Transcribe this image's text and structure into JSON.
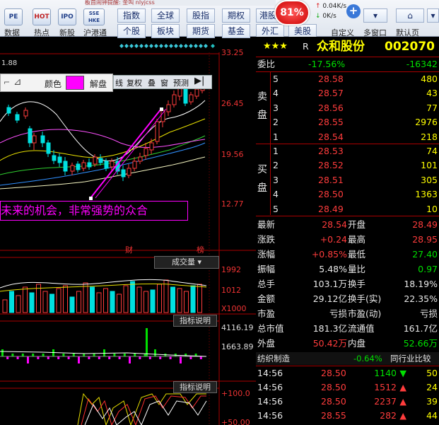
{
  "toolbar": {
    "title": "板首闹钟提醒: 金叫 nlyjcss",
    "icons": [
      {
        "name": "pe-icon",
        "text": "PE",
        "label": "数据"
      },
      {
        "name": "hot-icon",
        "text": "HOT",
        "label": "热点"
      },
      {
        "name": "new-icon",
        "text": "IPO",
        "label": "新股"
      },
      {
        "name": "ssehke-icon",
        "text": "SSE HKE",
        "label": "沪港通"
      }
    ],
    "nav_row1": [
      "指数",
      "全球",
      "股指",
      "期权",
      "港股"
    ],
    "nav_row2": [
      "个股",
      "板块",
      "期货",
      "基金",
      "外汇",
      "美股"
    ],
    "speed_percent": "81%",
    "net_up": "0.04K/s",
    "net_down": "0K/s",
    "right_labels": [
      "自定义",
      "多窗口",
      "默认页"
    ]
  },
  "chart_toolbar": {
    "color_label": "颜色",
    "unlock_label": "解盘",
    "buttons": [
      "线",
      "复权",
      "叠",
      "窗",
      "预测"
    ]
  },
  "price_axis": [
    "33.25",
    "26.45",
    "19.56",
    "12.77"
  ],
  "annotation_text": "未来的机会，非常强势的众合",
  "top_left_value": "1.88",
  "markers": {
    "cai": "财",
    "bang": "榜"
  },
  "volume": {
    "title": "成交量",
    "axis": [
      "1992",
      "1012",
      "X1000"
    ]
  },
  "indicator1": {
    "title": "指标说明",
    "axis": [
      "4116.19",
      "1663.89"
    ]
  },
  "indicator2": {
    "title": "指标说明",
    "axis": [
      "+100.0",
      "+50.00"
    ]
  },
  "stock": {
    "stars": "★★★",
    "r_mark": "R",
    "name": "众和股份",
    "code": "002070"
  },
  "weibi": {
    "label": "委比",
    "pct": "-17.56%",
    "diff": "-16342"
  },
  "sell_label": "卖盘",
  "buy_label": "买盘",
  "sell": [
    {
      "lvl": "5",
      "price": "28.58",
      "vol": "480"
    },
    {
      "lvl": "4",
      "price": "28.57",
      "vol": "43"
    },
    {
      "lvl": "3",
      "price": "28.56",
      "vol": "77"
    },
    {
      "lvl": "2",
      "price": "28.55",
      "vol": "2976"
    },
    {
      "lvl": "1",
      "price": "28.54",
      "vol": "218"
    }
  ],
  "buy": [
    {
      "lvl": "1",
      "price": "28.53",
      "vol": "74"
    },
    {
      "lvl": "2",
      "price": "28.52",
      "vol": "101"
    },
    {
      "lvl": "3",
      "price": "28.51",
      "vol": "305"
    },
    {
      "lvl": "4",
      "price": "28.50",
      "vol": "1363"
    },
    {
      "lvl": "5",
      "price": "28.49",
      "vol": "10"
    }
  ],
  "quote": [
    {
      "l1": "最新",
      "v1": "28.54",
      "c1": "red",
      "l2": "开盘",
      "v2": "28.49",
      "c2": "red"
    },
    {
      "l1": "涨跌",
      "v1": "+0.24",
      "c1": "red",
      "l2": "最高",
      "v2": "28.95",
      "c2": "red"
    },
    {
      "l1": "涨幅",
      "v1": "+0.85%",
      "c1": "red",
      "l2": "最低",
      "v2": "27.40",
      "c2": "green"
    },
    {
      "l1": "振幅",
      "v1": "5.48%",
      "c1": "white",
      "l2": "量比",
      "v2": "0.97",
      "c2": "green"
    },
    {
      "l1": "总手",
      "v1": "103.1万",
      "c1": "white",
      "l2": "换手",
      "v2": "18.19%",
      "c2": "white"
    },
    {
      "l1": "金额",
      "v1": "29.12亿",
      "c1": "white",
      "l2": "换手(实)",
      "v2": "22.35%",
      "c2": "white"
    },
    {
      "l1": "市盈",
      "v1": "亏损",
      "c1": "white",
      "l2": "市盈(动)",
      "v2": "亏损",
      "c2": "white"
    },
    {
      "l1": "总市值",
      "v1": "181.3亿",
      "c1": "white",
      "l2": "流通值",
      "v2": "161.7亿",
      "c2": "white"
    },
    {
      "l1": "外盘",
      "v1": "50.42万",
      "c1": "red",
      "l2": "内盘",
      "v2": "52.66万",
      "c2": "green"
    }
  ],
  "industry": {
    "name": "纺织制造",
    "pct": "-0.64%",
    "compare": "同行业比较"
  },
  "ticks": [
    {
      "time": "14:56",
      "price": "28.50",
      "vol": "1140",
      "dir": "down",
      "n": "50"
    },
    {
      "time": "14:56",
      "price": "28.50",
      "vol": "1512",
      "dir": "up",
      "n": "24"
    },
    {
      "time": "14:56",
      "price": "28.50",
      "vol": "2237",
      "dir": "up",
      "n": "39"
    },
    {
      "time": "14:56",
      "price": "28.55",
      "vol": "282",
      "dir": "up",
      "n": "44"
    }
  ],
  "colors": {
    "up": "#ff3c3c",
    "down": "#00e000",
    "bg": "#000000",
    "grid": "#aa0000",
    "accent": "#ff00ff"
  }
}
